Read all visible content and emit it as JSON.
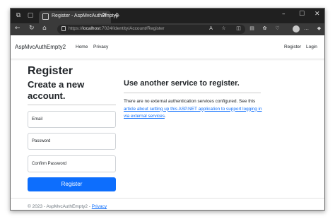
{
  "browser": {
    "tab_title": "Register - AspMvcAuthEmpty2",
    "tab_close": "✕",
    "new_tab": "+",
    "window_controls": {
      "minimize": "–",
      "maximize": "☐",
      "close": "✕"
    },
    "url_prefix": "https://",
    "url_host": "localhost",
    "url_rest": ":7024/Identity/Account/Register"
  },
  "site": {
    "brand": "AspMvcAuthEmpty2",
    "nav": {
      "home": "Home",
      "privacy": "Privacy",
      "register": "Register",
      "login": "Login"
    }
  },
  "register_form": {
    "heading": "Register",
    "subheading": "Create a new account.",
    "email_placeholder": "Email",
    "password_placeholder": "Password",
    "confirm_password_placeholder": "Confirm Password",
    "submit_label": "Register"
  },
  "external_services": {
    "heading": "Use another service to register.",
    "text_before": "There are no external authentication services configured. See this ",
    "link_text": "article about setting up this ASP.NET application to support logging in via external services",
    "text_after": "."
  },
  "footer": {
    "text": "© 2023 - AspMvcAuthEmpty2 - ",
    "privacy_link": "Privacy"
  },
  "colors": {
    "primary": "#0d6efd",
    "browser_dark": "#202020"
  }
}
